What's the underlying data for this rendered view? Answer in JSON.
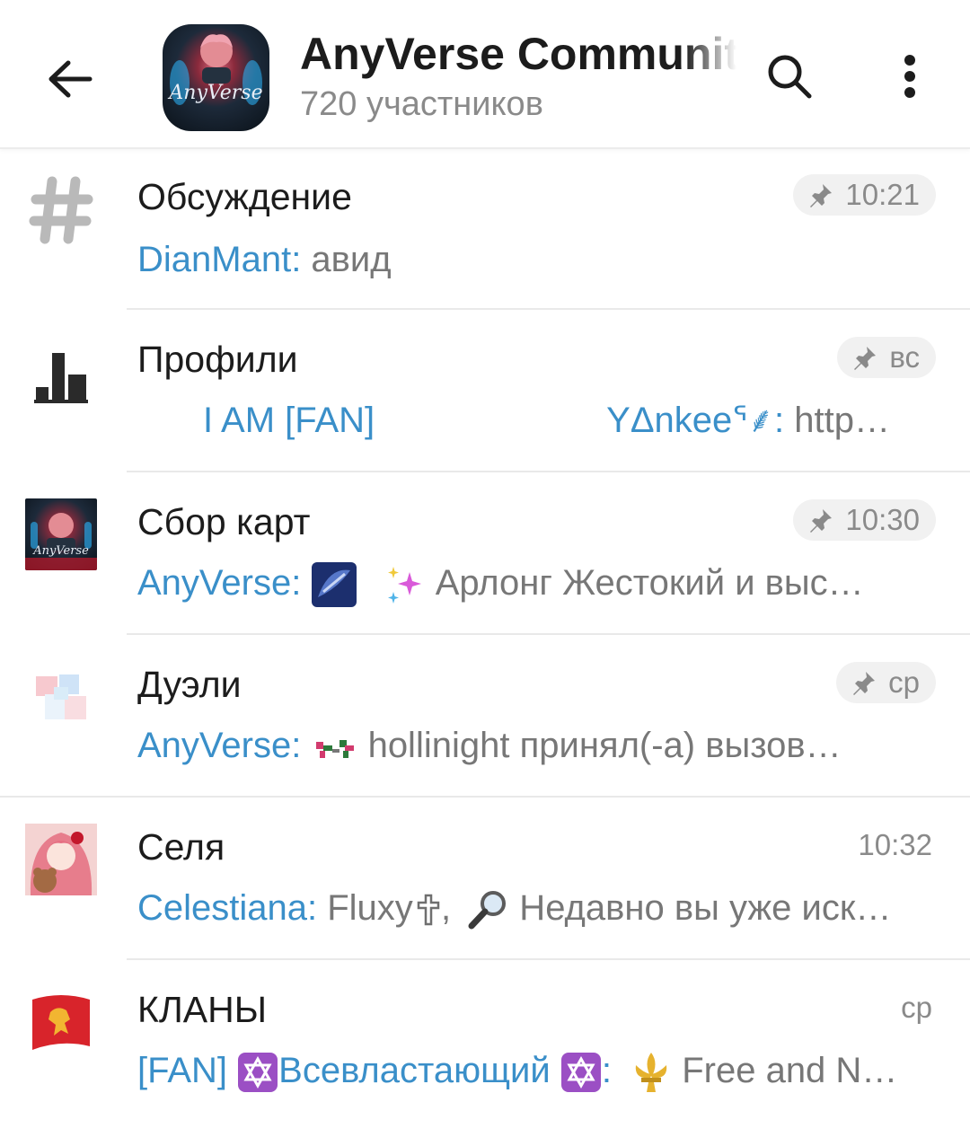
{
  "header": {
    "title": "AnyVerse Community",
    "subtitle": "720 участников",
    "avatar_text": "AnyVerse"
  },
  "topics": [
    {
      "title": "Обсуждение",
      "time": "10:21",
      "pinned": true,
      "sender": "DianMant:",
      "preview": " авид",
      "icon": "hashtag-icon"
    },
    {
      "title": "Профили",
      "time": "вс",
      "pinned": true,
      "sender": "I AM [FAN]",
      "sender2": "YΔnkee",
      "sender2_suffix": "ᕐ⸙:",
      "preview": " http…",
      "icon": "bar-chart-icon"
    },
    {
      "title": "Сбор карт",
      "time": "10:30",
      "pinned": true,
      "sender": "AnyVerse:",
      "preview": " Арлонг Жестокий и   выс…",
      "icon": "group-avatar-thumb"
    },
    {
      "title": "Дуэли",
      "time": "ср",
      "pinned": true,
      "sender": "AnyVerse:",
      "preview": " hollinight принял(-а) вызов…",
      "icon": "duel-icon"
    },
    {
      "title": "Селя",
      "time": "10:32",
      "pinned": false,
      "sender": "Celestiana:",
      "preview_before": " Fluxy",
      "preview_mid": ",",
      "preview": " Недавно вы уже иск…",
      "icon": "anime-girl-avatar"
    },
    {
      "title": "КЛАНЫ",
      "time": "ср",
      "pinned": false,
      "sender": "[FAN]",
      "sender_mid": "Всевластающий",
      "sender_end": ":",
      "preview": " Free and N…",
      "icon": "red-flag-lion-icon"
    }
  ]
}
